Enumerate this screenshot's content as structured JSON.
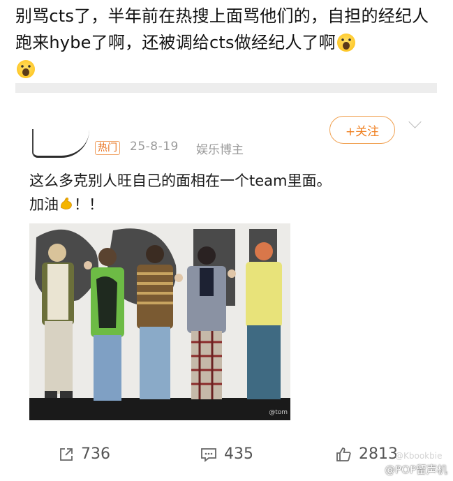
{
  "headline": {
    "text": "别骂cts了，半年前在热搜上面骂他们的，自担的经纪人跑来hybe了啊，还被调给cts做经纪人了啊"
  },
  "post": {
    "hot_tag": "热门",
    "date": "25-8-19",
    "role": "娱乐博主",
    "follow_label": "+关注",
    "text_line1": "这么多克别人旺自己的面相在一个team里面。",
    "text_line2_prefix": "加油",
    "text_line2_suffix": "！！",
    "photo_watermark": "@tom"
  },
  "actions": {
    "repost_count": "736",
    "comment_count": "435",
    "like_count": "2813"
  },
  "watermark": {
    "overlay": "@Kbookbie",
    "account": "@POP留声机"
  },
  "icons": {
    "scream_emoji": "face-screaming-in-fear-icon",
    "muscle_emoji": "flexed-biceps-icon",
    "repost": "share-out-icon",
    "comment": "comment-bubble-icon",
    "like": "thumbs-up-icon",
    "weibo": "weibo-logo-icon",
    "chevron": "chevron-down-icon"
  },
  "colors": {
    "follow_orange": "#f08020",
    "meta_gray": "#999999",
    "divider": "#ededed"
  }
}
